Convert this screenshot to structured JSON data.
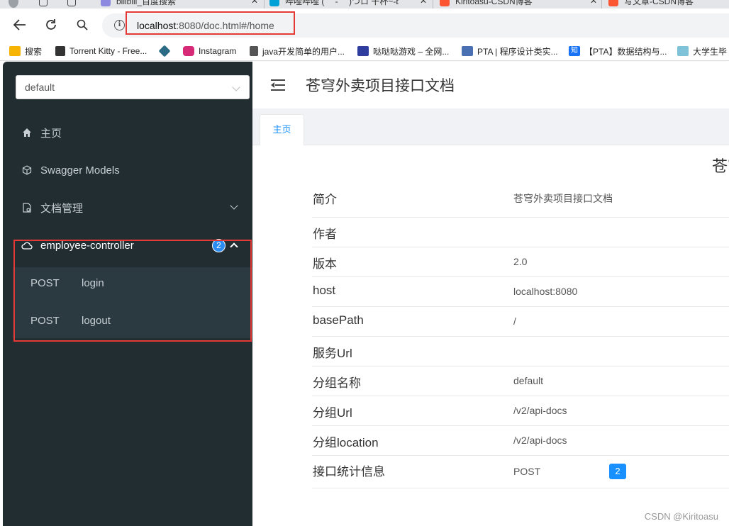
{
  "browser": {
    "tabs": [
      {
        "title": "bilibili_百度搜索",
        "fav_color": "#8e89e0"
      },
      {
        "title": "哔哩哔哩 ( ゜- ゜)つロ 干杯~-bilibili",
        "fav_color": "#00a1d6"
      },
      {
        "title": "Kiritoasu-CSDN博客",
        "fav_color": "#fc5531"
      },
      {
        "title": "写文章-CSDN博客",
        "fav_color": "#fc5531"
      }
    ],
    "url_host": "localhost",
    "url_rest": ":8080/doc.html#/home",
    "bookmarks": [
      {
        "label": "搜索",
        "color": "#f6b400"
      },
      {
        "label": "Torrent Kitty - Free...",
        "color": "#333333"
      },
      {
        "label": "",
        "color": "#2b6b85"
      },
      {
        "label": "Instagram",
        "color": "#d62976"
      },
      {
        "label": "java开发简单的用户...",
        "color": "#444444"
      },
      {
        "label": "哒哒哒游戏 – 全网...",
        "color": "#2f3e9e"
      },
      {
        "label": "PTA | 程序设计类实...",
        "color": "#4a6fb3"
      },
      {
        "label": "【PTA】数据结构与...",
        "color": "#1772f6"
      },
      {
        "label": "大学生毕",
        "color": "#7fc3d8"
      }
    ],
    "bookmark_zhi": "知"
  },
  "sidebar": {
    "group_select": "default",
    "menu": [
      {
        "label": "主页"
      },
      {
        "label": "Swagger Models"
      },
      {
        "label": "文档管理"
      }
    ],
    "controller": {
      "label": "employee-controller",
      "count": "2",
      "apis": [
        {
          "method": "POST",
          "path": "login"
        },
        {
          "method": "POST",
          "path": "logout"
        }
      ]
    }
  },
  "header": {
    "title": "苍穹外卖项目接口文档"
  },
  "doc_tab": "主页",
  "doc": {
    "heading": "苍穹外卖项目接口文档",
    "rows": [
      {
        "key": "简介",
        "value": "苍穹外卖项目接口文档"
      },
      {
        "key": "作者",
        "value": ""
      },
      {
        "key": "版本",
        "value": "2.0"
      },
      {
        "key": "host",
        "value": "localhost:8080"
      },
      {
        "key": "basePath",
        "value": "/"
      },
      {
        "key": "服务Url",
        "value": ""
      },
      {
        "key": "分组名称",
        "value": "default"
      },
      {
        "key": "分组Url",
        "value": "/v2/api-docs"
      },
      {
        "key": "分组location",
        "value": "/v2/api-docs"
      },
      {
        "key": "接口统计信息",
        "value": "POST"
      }
    ],
    "stat_count": "2"
  },
  "watermark": "CSDN @Kiritoasu",
  "colors": {
    "sidebar_bg": "#222d32",
    "accent": "#1890ff",
    "highlight_box": "#e53935"
  }
}
